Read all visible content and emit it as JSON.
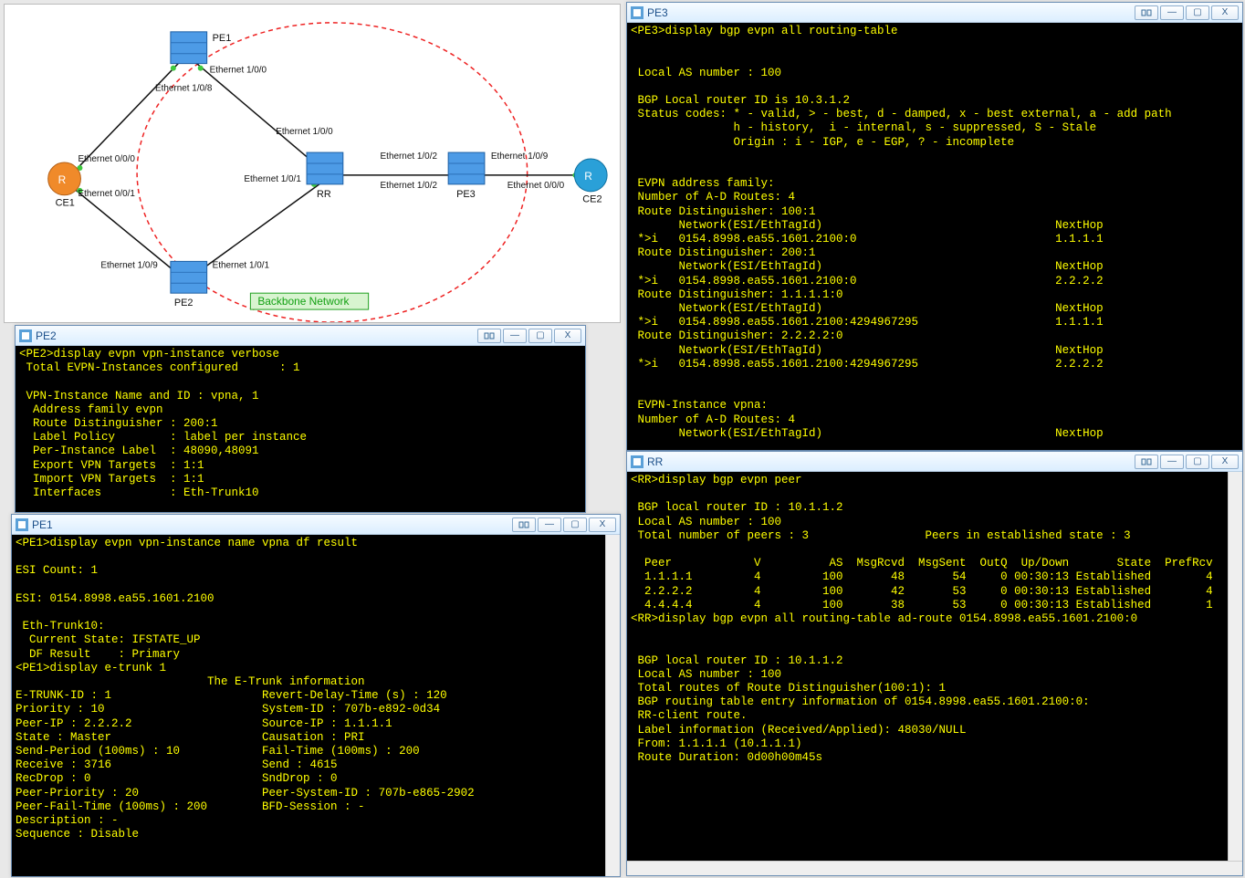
{
  "diagram": {
    "nodes": {
      "CE1": "CE1",
      "CE2": "CE2",
      "PE1": "PE1",
      "PE2": "PE2",
      "PE3": "PE3",
      "RR": "RR"
    },
    "interfaces": {
      "ce1_top": "Ethernet 0/0/0",
      "ce1_bottom": "Ethernet 0/0/1",
      "pe1_west": "Ethernet 1/0/8",
      "pe1_south": "Ethernet 1/0/0",
      "pe2_west": "Ethernet 1/0/9",
      "pe2_north": "Ethernet 1/0/1",
      "rr_north": "Ethernet 1/0/0",
      "rr_west": "Ethernet 1/0/1",
      "rr_east": "Ethernet 1/0/2",
      "pe3_west": "Ethernet 1/0/2",
      "pe3_east": "Ethernet 1/0/9",
      "ce2_west": "Ethernet 0/0/0"
    },
    "backbone": "Backbone Network"
  },
  "pe2": {
    "title": "PE2",
    "text": "<PE2>display evpn vpn-instance verbose\n Total EVPN-Instances configured      : 1\n\n VPN-Instance Name and ID : vpna, 1\n  Address family evpn\n  Route Distinguisher : 200:1\n  Label Policy        : label per instance\n  Per-Instance Label  : 48090,48091\n  Export VPN Targets  : 1:1\n  Import VPN Targets  : 1:1\n  Interfaces          : Eth-Trunk10"
  },
  "pe1": {
    "title": "PE1",
    "text": "<PE1>display evpn vpn-instance name vpna df result\n\nESI Count: 1\n\nESI: 0154.8998.ea55.1601.2100\n\n Eth-Trunk10:\n  Current State: IFSTATE_UP\n  DF Result    : Primary\n<PE1>display e-trunk 1\n                            The E-Trunk information\nE-TRUNK-ID : 1                      Revert-Delay-Time (s) : 120\nPriority : 10                       System-ID : 707b-e892-0d34\nPeer-IP : 2.2.2.2                   Source-IP : 1.1.1.1\nState : Master                      Causation : PRI\nSend-Period (100ms) : 10            Fail-Time (100ms) : 200\nReceive : 3716                      Send : 4615\nRecDrop : 0                         SndDrop : 0\nPeer-Priority : 20                  Peer-System-ID : 707b-e865-2902\nPeer-Fail-Time (100ms) : 200        BFD-Session : -\nDescription : -\nSequence : Disable"
  },
  "pe3": {
    "title": "PE3",
    "text": "<PE3>display bgp evpn all routing-table\n\n\n Local AS number : 100\n\n BGP Local router ID is 10.3.1.2\n Status codes: * - valid, > - best, d - damped, x - best external, a - add path\n               h - history,  i - internal, s - suppressed, S - Stale\n               Origin : i - IGP, e - EGP, ? - incomplete\n\n\n EVPN address family:\n Number of A-D Routes: 4\n Route Distinguisher: 100:1\n       Network(ESI/EthTagId)                                  NextHop\n *>i   0154.8998.ea55.1601.2100:0                             1.1.1.1\n Route Distinguisher: 200:1\n       Network(ESI/EthTagId)                                  NextHop\n *>i   0154.8998.ea55.1601.2100:0                             2.2.2.2\n Route Distinguisher: 1.1.1.1:0\n       Network(ESI/EthTagId)                                  NextHop\n *>i   0154.8998.ea55.1601.2100:4294967295                    1.1.1.1\n Route Distinguisher: 2.2.2.2:0\n       Network(ESI/EthTagId)                                  NextHop\n *>i   0154.8998.ea55.1601.2100:4294967295                    2.2.2.2\n\n\n EVPN-Instance vpna:\n Number of A-D Routes: 4\n       Network(ESI/EthTagId)                                  NextHop"
  },
  "rr": {
    "title": "RR",
    "text": "<RR>display bgp evpn peer\n\n BGP local router ID : 10.1.1.2\n Local AS number : 100\n Total number of peers : 3                 Peers in established state : 3\n\n  Peer            V          AS  MsgRcvd  MsgSent  OutQ  Up/Down       State  PrefRcv\n  1.1.1.1         4         100       48       54     0 00:30:13 Established        4\n  2.2.2.2         4         100       42       53     0 00:30:13 Established        4\n  4.4.4.4         4         100       38       53     0 00:30:13 Established        1\n<RR>display bgp evpn all routing-table ad-route 0154.8998.ea55.1601.2100:0\n\n\n BGP local router ID : 10.1.1.2\n Local AS number : 100\n Total routes of Route Distinguisher(100:1): 1\n BGP routing table entry information of 0154.8998.ea55.1601.2100:0:\n RR-client route.\n Label information (Received/Applied): 48030/NULL\n From: 1.1.1.1 (10.1.1.1)\n Route Duration: 0d00h00m45s"
  }
}
